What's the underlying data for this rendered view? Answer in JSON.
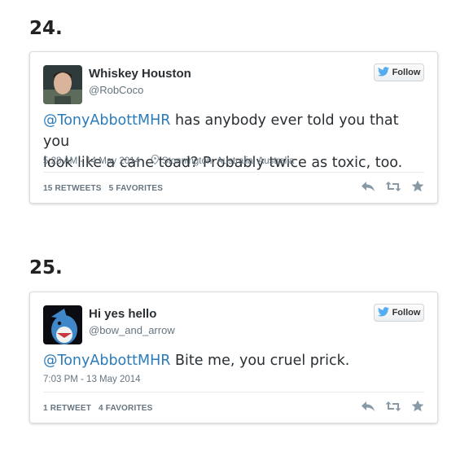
{
  "items": [
    {
      "number": "24.",
      "name": "Whiskey Houston",
      "handle": "@RobCoco",
      "follow_label": "Follow",
      "mention": "@TonyAbbottMHR",
      "text_line1_rest": " has anybody ever told you that you",
      "text_line2": "look like a cane toad? Probably twice as toxic, too.",
      "time": "5:28 AM - 14 May 2014",
      "location": "Stonnington, Australia, Australia",
      "retweets": "15 RETWEETS",
      "favorites": "5 FAVORITES"
    },
    {
      "number": "25.",
      "name": "Hi yes hello",
      "handle": "@bow_and_arrow",
      "follow_label": "Follow",
      "mention": "@TonyAbbottMHR",
      "text_rest": " Bite me, you cruel prick.",
      "time": "7:03 PM - 13 May 2014",
      "retweets": "1 RETWEET",
      "favorites": "4 FAVORITES"
    }
  ],
  "colors": {
    "mention": "#2b7bb9",
    "twitter_blue": "#55acee",
    "meta_gray": "#66757f",
    "action_gray": "#8899a6"
  },
  "icons": [
    "twitter-bird-icon",
    "location-pin-icon",
    "reply-icon",
    "retweet-icon",
    "favorite-star-icon"
  ]
}
